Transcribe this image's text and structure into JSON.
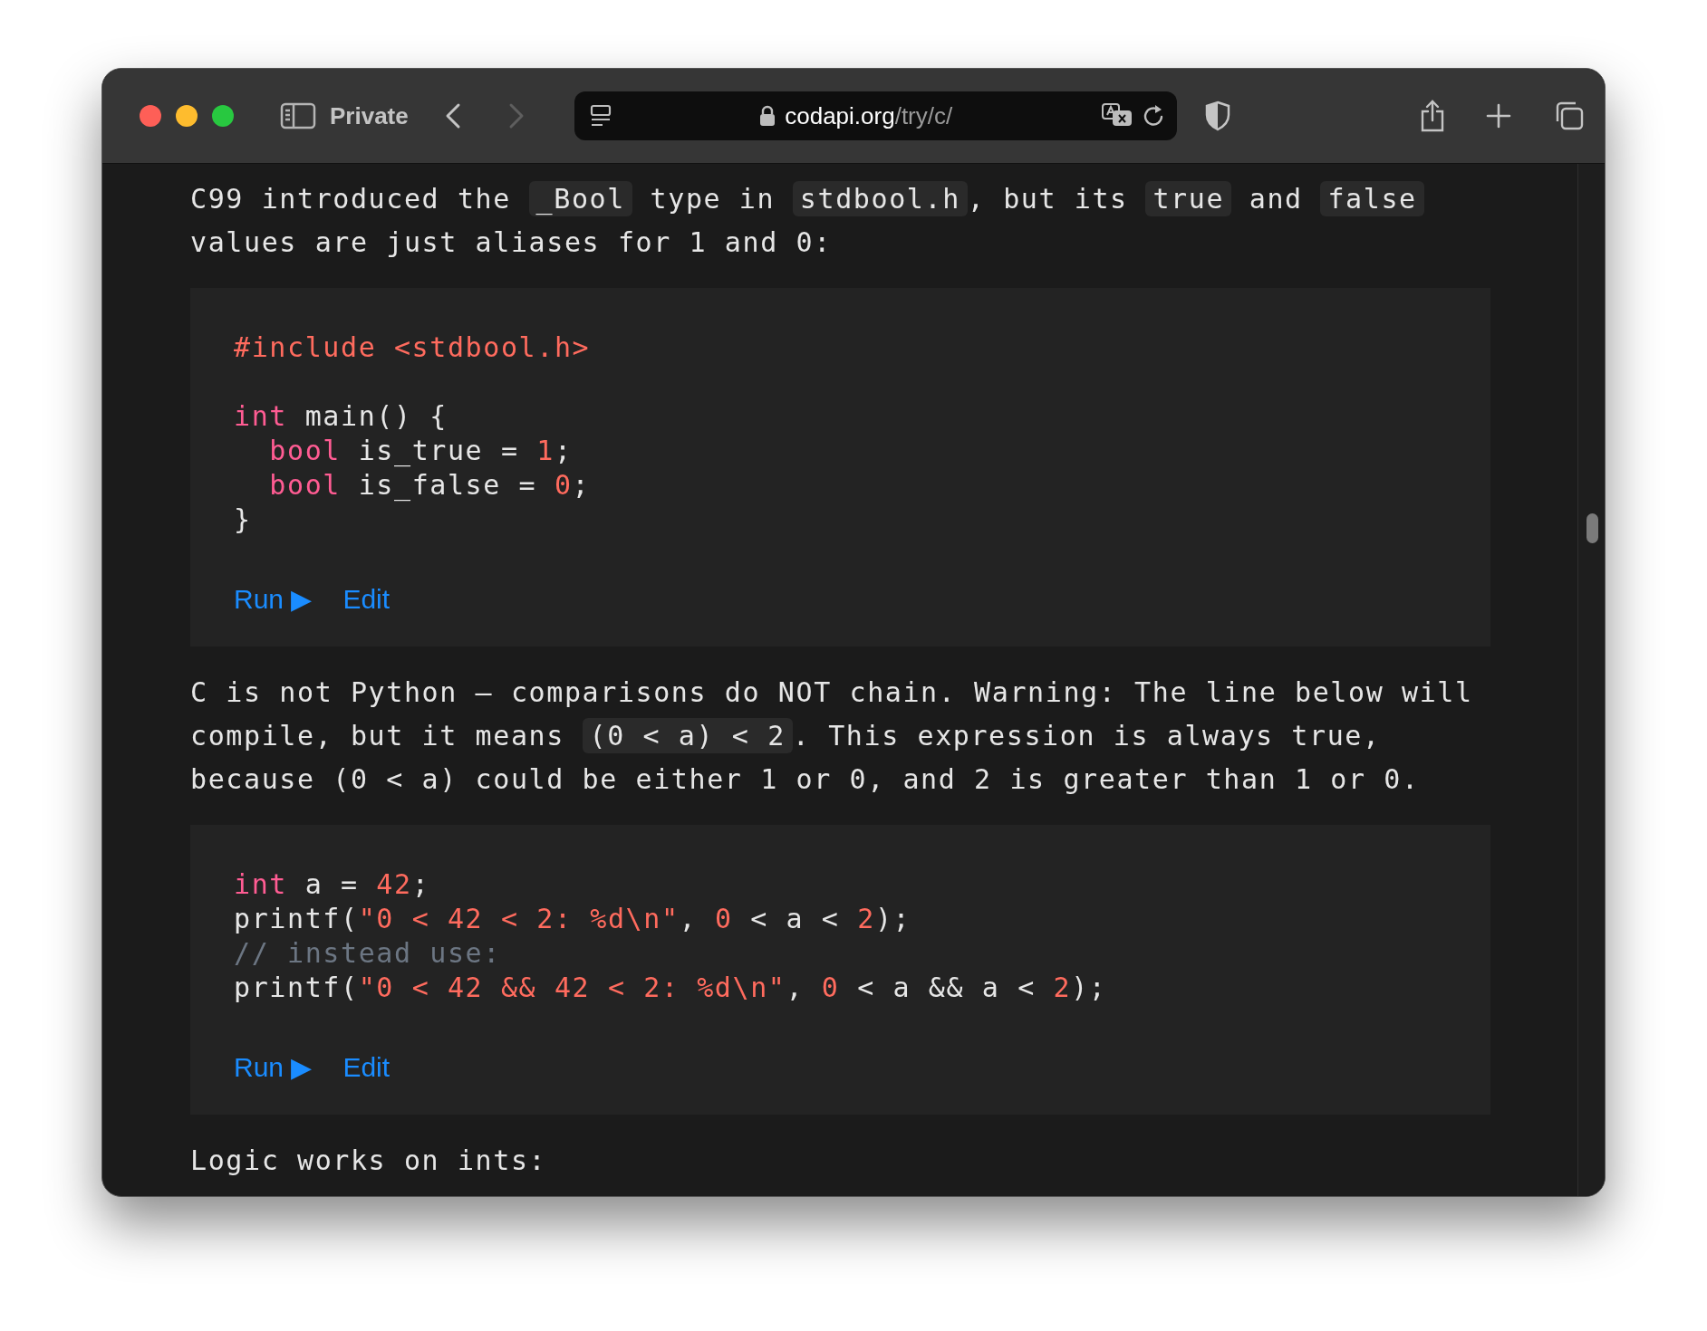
{
  "toolbar": {
    "private_label": "Private",
    "back_enabled": true,
    "forward_enabled": false,
    "address": {
      "domain": "codapi.org",
      "path": "/try/c/"
    }
  },
  "content": [
    {
      "kind": "paragraph",
      "segments": [
        {
          "kind": "text",
          "text": "C99 introduced the "
        },
        {
          "kind": "code",
          "text": "_Bool"
        },
        {
          "kind": "text",
          "text": " type in "
        },
        {
          "kind": "code",
          "text": "stdbool.h"
        },
        {
          "kind": "text",
          "text": ", but its "
        },
        {
          "kind": "code",
          "text": "true"
        },
        {
          "kind": "text",
          "text": " and "
        },
        {
          "kind": "code",
          "text": "false"
        },
        {
          "kind": "text",
          "text": " values are just aliases for 1 and 0:"
        }
      ]
    },
    {
      "kind": "code_block",
      "groups": [
        [
          [
            {
              "kind": "preproc",
              "text": "#include <stdbool.h>"
            }
          ]
        ],
        [
          [
            {
              "kind": "keyword",
              "text": "int"
            },
            {
              "kind": "plain",
              "text": " main() {"
            }
          ],
          [
            {
              "kind": "keyword",
              "text": "  bool"
            },
            {
              "kind": "plain",
              "text": " is_true = "
            },
            {
              "kind": "number",
              "text": "1"
            },
            {
              "kind": "plain",
              "text": ";"
            }
          ],
          [
            {
              "kind": "keyword",
              "text": "  bool"
            },
            {
              "kind": "plain",
              "text": " is_false = "
            },
            {
              "kind": "number",
              "text": "0"
            },
            {
              "kind": "plain",
              "text": ";"
            }
          ],
          [
            {
              "kind": "plain",
              "text": "}"
            }
          ]
        ]
      ],
      "run_label": "Run ▶",
      "edit_label": "Edit"
    },
    {
      "kind": "paragraph",
      "segments": [
        {
          "kind": "text",
          "text": "C is not Python — comparisons do NOT chain. Warning: The line below will compile, but it means "
        },
        {
          "kind": "code",
          "text": "(0 < a) < 2"
        },
        {
          "kind": "text",
          "text": ". This expression is always true, because (0 < a) could be either 1 or 0, and 2 is greater than 1 or 0."
        }
      ]
    },
    {
      "kind": "code_block",
      "groups": [
        [
          [
            {
              "kind": "keyword",
              "text": "int"
            },
            {
              "kind": "plain",
              "text": " a = "
            },
            {
              "kind": "number",
              "text": "42"
            },
            {
              "kind": "plain",
              "text": ";"
            }
          ],
          [
            {
              "kind": "plain",
              "text": "printf("
            },
            {
              "kind": "string",
              "text": "\"0 < 42 < 2: %d\\n\""
            },
            {
              "kind": "plain",
              "text": ", "
            },
            {
              "kind": "number",
              "text": "0"
            },
            {
              "kind": "plain",
              "text": " < a < "
            },
            {
              "kind": "number",
              "text": "2"
            },
            {
              "kind": "plain",
              "text": ");"
            }
          ],
          [
            {
              "kind": "comment",
              "text": "// instead use:"
            }
          ],
          [
            {
              "kind": "plain",
              "text": "printf("
            },
            {
              "kind": "string",
              "text": "\"0 < 42 && 42 < 2: %d\\n\""
            },
            {
              "kind": "plain",
              "text": ", "
            },
            {
              "kind": "number",
              "text": "0"
            },
            {
              "kind": "plain",
              "text": " < a && a < "
            },
            {
              "kind": "number",
              "text": "2"
            },
            {
              "kind": "plain",
              "text": ");"
            }
          ]
        ]
      ],
      "run_label": "Run ▶",
      "edit_label": "Edit"
    },
    {
      "kind": "paragraph",
      "segments": [
        {
          "kind": "text",
          "text": "Logic works on ints:"
        }
      ]
    }
  ]
}
